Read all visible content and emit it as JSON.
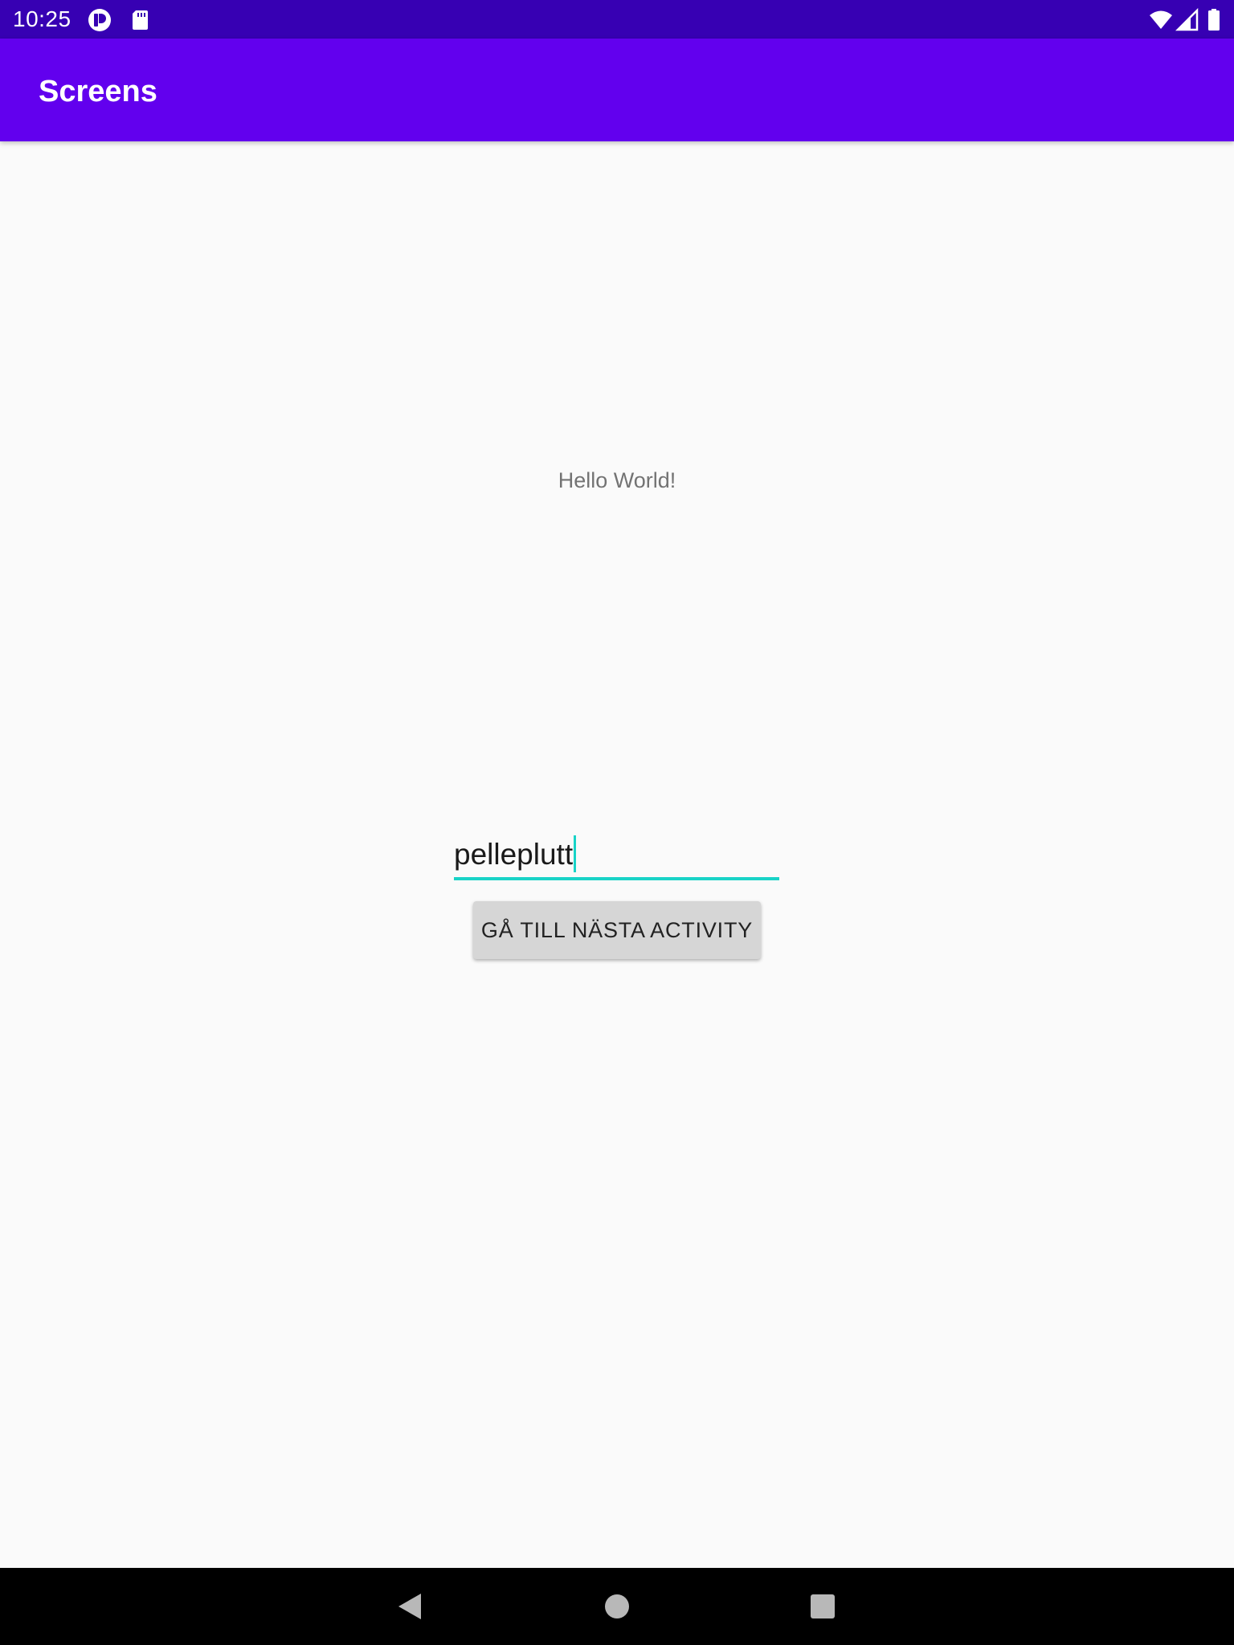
{
  "status_bar": {
    "time": "10:25",
    "icons": [
      "notification-app-icon",
      "sd-card-icon",
      "wifi-icon",
      "cellular-signal-icon",
      "battery-icon"
    ],
    "background_color": "#3700b3"
  },
  "app_bar": {
    "title": "Screens",
    "background_color": "#6200ee"
  },
  "content": {
    "hello_text": "Hello World!",
    "text_field": {
      "value": "pelleplutt",
      "accent_color": "#18d3c7"
    },
    "button_label": "GÅ TILL NÄSTA ACTIVITY"
  },
  "nav_bar": {
    "buttons": [
      "back-icon",
      "home-icon",
      "recents-icon"
    ]
  }
}
